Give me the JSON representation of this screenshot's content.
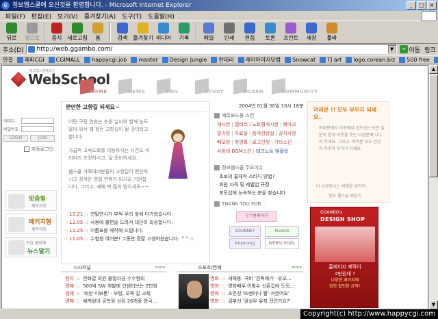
{
  "window": {
    "title_prefix": "",
    "title_main": "정보웹스쿨에 오신것을 환영합니다. - Microsoft Internet Explorer",
    "controls": [
      "_",
      "□",
      "×"
    ]
  },
  "menu": [
    "파일(F)",
    "편집(E)",
    "보기(V)",
    "즐겨찾기(A)",
    "도구(T)",
    "도움말(H)"
  ],
  "toolbar": [
    {
      "label": "뒤로",
      "icon": "back-icon",
      "color": "#2d8a2d",
      "disabled": false
    },
    {
      "label": "앞으로",
      "icon": "forward-icon",
      "color": "#9a9a9a",
      "disabled": true
    },
    {
      "label": "중지",
      "icon": "stop-icon",
      "color": "#c02020",
      "disabled": false
    },
    {
      "label": "새로고침",
      "icon": "refresh-icon",
      "color": "#2d8a2d",
      "disabled": false
    },
    {
      "label": "홈",
      "icon": "home-icon",
      "color": "#d0a030",
      "disabled": false
    },
    {
      "label": "검색",
      "icon": "search-icon",
      "color": "#3a6ad0",
      "disabled": false
    },
    {
      "label": "즐겨찾기",
      "icon": "favorites-icon",
      "color": "#e0b020",
      "disabled": false
    },
    {
      "label": "미디어",
      "icon": "media-icon",
      "color": "#3a8ad0",
      "disabled": false
    },
    {
      "label": "기록",
      "icon": "history-icon",
      "color": "#2d9a6a",
      "disabled": false
    },
    {
      "label": "메일",
      "icon": "mail-icon",
      "color": "#5a7ad0",
      "disabled": false
    },
    {
      "label": "인쇄",
      "icon": "print-icon",
      "color": "#707070",
      "disabled": false
    },
    {
      "label": "편집",
      "icon": "edit-icon",
      "color": "#3a6ad0",
      "disabled": false
    },
    {
      "label": "토론",
      "icon": "discuss-icon",
      "color": "#3a8ad0",
      "disabled": false
    },
    {
      "label": "프린트",
      "icon": "print-screen-icon",
      "color": "#9a5ad0",
      "disabled": false
    },
    {
      "label": "새창",
      "icon": "new-window-icon",
      "color": "#3a6ad0",
      "disabled": false
    },
    {
      "label": "툴바",
      "icon": "toolbar-icon",
      "color": "#d08a30",
      "disabled": false
    }
  ],
  "address": {
    "label": "주소(D)",
    "url": "http://web.ggambo.com/",
    "go_label": "이동",
    "links_label": "링크"
  },
  "links": [
    "연결",
    "해피CGI",
    "CGIMALL",
    "happycgi.job",
    "master",
    "Design Jungle",
    "딴데리",
    "레이아이지닷컴",
    "Snowcat",
    "TJ art",
    "logo,corean.biz",
    "500 free",
    "앱고"
  ],
  "site": {
    "logo_small": "정보웹스쿨에오신",
    "logo": "WebSchool",
    "nav": [
      "HOME",
      "NEWS",
      "PDS",
      "STUDY",
      "BOARD",
      "COMMUNITY"
    ]
  },
  "login": {
    "id_label": "아이디",
    "pw_label": "비밀번호",
    "login_btn": "LOGIN",
    "join_btn": "JOIN",
    "auto_login": "자동로그인"
  },
  "promos": [
    {
      "title": "맞춤형",
      "sub": "제작의뢰"
    },
    {
      "title": "패키지형",
      "sub": "제작의뢰"
    },
    {
      "title": "뉴스알기",
      "sub": "커뮤 홈피에"
    }
  ],
  "greeting": {
    "title": "편안한 고향길 되세요~",
    "paragraphs": [
      "어떤 구정 연휴는 추운 날씨와 함께 눈도 많이 와서 꽤 힘든 고향길이 될 것이라고 합니다.",
      "가급적 고속도로를 이용하시는 시간도 미리미리 조정하시고, 잘 준비하세요..",
      "웹스쿨 가족여러분들의 고향길이 편안하시고 정겨운 명절 연휴가 되시길 기원합니다. 그리고, 새해 복 많이 받으세요~~"
    ]
  },
  "news": [
    {
      "date": "12.21",
      "text": "연말연시가 부쩍 우리 앞에 다가왔습니다."
    },
    {
      "date": "12.05",
      "text": "사용에 불편을 드려서 대단히 죄송합니다."
    },
    {
      "date": "11.25",
      "text": "이름표를 제작해 드립니다."
    },
    {
      "date": "11.05",
      "text": "수험생 여러분! 그동안 정말 고생하셨습니다. ^^:::"
    }
  ],
  "date_line": "2004년 01월 30일 10시 16분",
  "skins": {
    "header": "제로보드용 스킨",
    "rows": [
      [
        "게시판",
        "갤러리",
        "노트형게시판",
        "북마크"
      ],
      [
        "일기장",
        "자료실",
        "음악감상실",
        "공지사항"
      ],
      [
        "메모장",
        "방명록",
        "로그인셋",
        "기타스킨"
      ],
      [
        "사랑비 BGM스킨",
        "테크노트 템플릿"
      ]
    ]
  },
  "issues": {
    "header": "정보웹스쿨 주요이슈",
    "items": [
      "초보의 홈재작 스타디 방법?",
      "회원 자격 및 레벨업 규정",
      "포토샵에 능숙하신 분을 찾습니다"
    ]
  },
  "thanks": {
    "header": "THANK YOU FOR...",
    "banners": [
      "우수홈페이지",
      "Haleaa",
      "SOUNNET",
      "Pixelist",
      "Knyorang",
      "WEBSCHOOL"
    ]
  },
  "ad1": {
    "headline": "여러분 !! 모두 부우자 되세요..",
    "body": "여러분께서 이곳에서 얻으시는 모든 일분의 양과 이웃을 웃는 다른분께 나누어 주세요. 그리고, 여러분 모두 건강하 하루하 부자가 되세요.",
    "footer": "더 상큼하시는 새해를 위하여...",
    "bottom": "정보 웹스쿨 패밀리"
  },
  "ad2": {
    "brand": "GGAMBO's",
    "title": "DESIGN SHOP",
    "line1": "홈페이지 제작이",
    "line2": "4만원대 ?",
    "line3": "다양한 패키지에",
    "line4": "함한 할인된 금액?"
  },
  "sections": {
    "left_title": "시사저널",
    "left_items": [
      {
        "cat": "정치",
        "text": "한화갑 의원 불법자금 수수혐의"
      },
      {
        "cat": "경제",
        "text": "500억 SW 개발에 인센티브는 2만원"
      },
      {
        "cat": "경제",
        "text": "'비판 미보통' · 부팅, 오죽 같 크체"
      },
      {
        "cat": "경제",
        "text": "세계원이 공학원 선정 26개중 한국..."
      }
    ],
    "right_title": "스포츠/연예",
    "right_items": [
      {
        "cat": "영화",
        "text": "새해동, 국비 '감독제가' ·유오..."
      },
      {
        "cat": "영화",
        "text": "영화배우 이범수 신혼집에 도둑..."
      },
      {
        "cat": "영화",
        "text": "조민성 '뜨밴이나 빨'·쳐겼어요'"
      },
      {
        "cat": "영화",
        "text": "김부선 '권상우 유죄 전인가요?'"
      }
    ],
    "more": "more"
  },
  "copyright": "Copyright(c) http://www.happycgi.com"
}
